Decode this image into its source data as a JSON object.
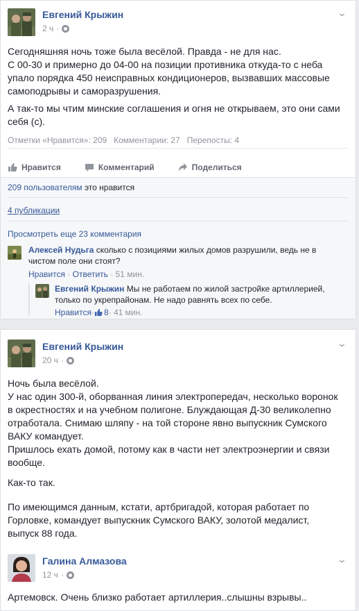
{
  "post1": {
    "author": "Евгений Крыжин",
    "time": "2 ч",
    "paragraphs": [
      "Сегодняшняя ночь тоже была весёлой. Правда - не для нас.\nС 00-30 и примерно до 04-00 на позиции противника откуда-то с неба упало порядка 450 неисправных кондиционеров, вызвавших массовые самоподрывы и саморазрушения.",
      "А так-то мы чтим минские соглашения и огня не открываем, это они сами себя (с)."
    ],
    "stats": {
      "likes": "Отметки «Нравится»: 209",
      "comments": "Комментарии: 27",
      "shares": "Перепосты: 4"
    },
    "actions": {
      "like": "Нравится",
      "comment": "Комментарий",
      "share": "Поделиться"
    },
    "likes_line": {
      "count": "209 пользователям",
      "suffix": " это нравится"
    },
    "publications": "4 публикации",
    "more_comments": "Просмотреть еще 23 комментария",
    "comment1": {
      "author": "Алексей Нудьга",
      "text": " сколько с позициями жилых домов разрушили, ведь не в чистом поле они стоят?",
      "like": "Нравится",
      "dot": " · ",
      "reply": "Ответить",
      "time": " · 51 мин."
    },
    "reply1": {
      "author": "Евгений Крыжин",
      "text": " Мы не работаем по жилой застройке артиллерией, только по укрепрайонам. Не надо равнять всех по себе.",
      "like": "Нравится",
      "dot": " · ",
      "like_count": "8",
      "time": " · 41 мин."
    }
  },
  "post2": {
    "author": "Евгений Крыжин",
    "time": "20 ч",
    "paragraphs": [
      "Ночь была весёлой.\nУ нас один 300-й, оборванная линия электропередач, несколько воронок в окрестностях и на учебном полигоне. Блуждающая Д-30 великолепно отработала. Снимаю шляпу - на той стороне явно выпускник Сумского ВАКУ командует.\nПришлось ехать домой, потому как в части нет электроэнергии и связи вообще.",
      "Как-то так.",
      "По имеющимся данным, кстати, артбригадой, которая работает по Горловке, командует выпускник Сумского ВАКУ, золотой медалист, выпуск 88 года."
    ]
  },
  "post3": {
    "author": "Галина Алмазова",
    "time": "12 ч",
    "text": "Артемовск. Очень близко работает артиллерия..слышны взрывы.."
  },
  "colors": {
    "link": "#365899",
    "meta": "#90949c",
    "background": "#e9ebee",
    "like_blue": "#4267b2"
  }
}
